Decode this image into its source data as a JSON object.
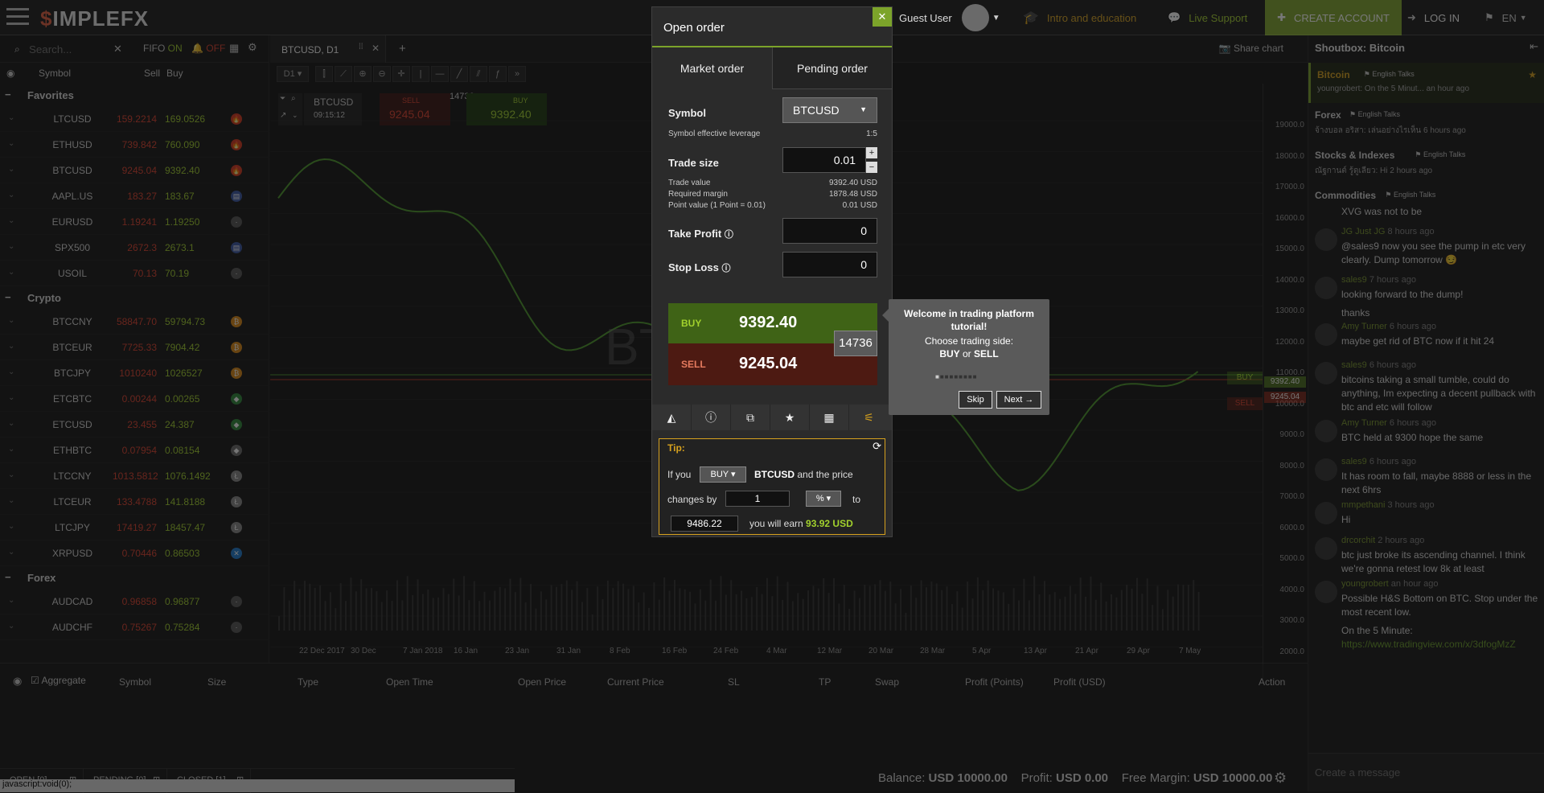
{
  "brand": {
    "logo_pre": "$",
    "logo_text": "IMPLEFX"
  },
  "topbar": {
    "guest": "Guest User",
    "intro": "Intro and education",
    "support": "Live Support",
    "create": "CREATE ACCOUNT",
    "login": "LOG IN",
    "lang": "EN"
  },
  "watchlist": {
    "search_placeholder": "Search...",
    "fifo_label": "FIFO",
    "fifo_on": "ON",
    "off_label": "OFF",
    "col_symbol": "Symbol",
    "col_sell": "Sell",
    "col_buy": "Buy",
    "groups": [
      {
        "name": "Favorites",
        "rows": [
          {
            "sym": "LTCUSD",
            "sell": "159.2214",
            "buy": "169.0526",
            "icon": "flame-icon"
          },
          {
            "sym": "ETHUSD",
            "sell": "739.842",
            "buy": "760.090",
            "icon": "flame-icon"
          },
          {
            "sym": "BTCUSD",
            "sell": "9245.04",
            "buy": "9392.40",
            "icon": "flame-icon"
          },
          {
            "sym": "AAPL.US",
            "sell": "183.27",
            "buy": "183.67",
            "icon": "us-flag-icon"
          },
          {
            "sym": "EURUSD",
            "sell": "1.19241",
            "buy": "1.19250",
            "icon": "curr-icon"
          },
          {
            "sym": "SPX500",
            "sell": "2672.3",
            "buy": "2673.1",
            "icon": "us-flag-icon"
          },
          {
            "sym": "USOIL",
            "sell": "70.13",
            "buy": "70.19",
            "icon": "curr-icon"
          }
        ]
      },
      {
        "name": "Crypto",
        "rows": [
          {
            "sym": "BTCCNY",
            "sell": "58847.70",
            "buy": "59794.73",
            "icon": "bitcoin-icon"
          },
          {
            "sym": "BTCEUR",
            "sell": "7725.33",
            "buy": "7904.42",
            "icon": "bitcoin-icon"
          },
          {
            "sym": "BTCJPY",
            "sell": "1010240",
            "buy": "1026527",
            "icon": "bitcoin-icon"
          },
          {
            "sym": "ETCBTC",
            "sell": "0.00244",
            "buy": "0.00265",
            "icon": "etc-icon"
          },
          {
            "sym": "ETCUSD",
            "sell": "23.455",
            "buy": "24.387",
            "icon": "etc-icon"
          },
          {
            "sym": "ETHBTC",
            "sell": "0.07954",
            "buy": "0.08154",
            "icon": "eth-icon"
          },
          {
            "sym": "LTCCNY",
            "sell": "1013.5812",
            "buy": "1076.1492",
            "icon": "ltc-icon"
          },
          {
            "sym": "LTCEUR",
            "sell": "133.4788",
            "buy": "141.8188",
            "icon": "ltc-icon"
          },
          {
            "sym": "LTCJPY",
            "sell": "17419.27",
            "buy": "18457.47",
            "icon": "ltc-icon"
          },
          {
            "sym": "XRPUSD",
            "sell": "0.70446",
            "buy": "0.86503",
            "icon": "xrp-icon"
          }
        ]
      },
      {
        "name": "Forex",
        "rows": [
          {
            "sym": "AUDCAD",
            "sell": "0.96858",
            "buy": "0.96877",
            "icon": "curr-icon"
          },
          {
            "sym": "AUDCHF",
            "sell": "0.75267",
            "buy": "0.75284",
            "icon": "curr-icon"
          }
        ]
      }
    ]
  },
  "chart": {
    "tab": "BTCUSD, D1",
    "timeframe": "D1",
    "share": "Share chart",
    "quote_symbol": "BTCUSD",
    "quote_time": "09:15:12",
    "quote_sell_label": "SELL",
    "quote_sell": "9245.04",
    "quote_buy_label": "BUY",
    "quote_buy": "9392.40",
    "spread": "14736",
    "watermark": "BTC",
    "yticks": [
      "19000.0",
      "18000.0",
      "17000.0",
      "16000.0",
      "15000.0",
      "14000.0",
      "13000.0",
      "12000.0",
      "11000.0",
      "10000.0",
      "9000.0",
      "8000.0",
      "7000.0",
      "6000.0",
      "5000.0",
      "4000.0",
      "3000.0",
      "2000.0"
    ],
    "xticks": [
      "22 Dec 2017",
      "30 Dec",
      "7 Jan 2018",
      "16 Jan",
      "23 Jan",
      "31 Jan",
      "8 Feb",
      "16 Feb",
      "24 Feb",
      "4 Mar",
      "12 Mar",
      "20 Mar",
      "28 Mar",
      "5 Apr",
      "13 Apr",
      "21 Apr",
      "29 Apr",
      "7 May"
    ],
    "buy_tag": "BUY",
    "buy_price": "9392.40",
    "sell_tag": "SELL",
    "sell_price": "9245.04"
  },
  "positions": {
    "aggregate": "Aggregate",
    "cols": [
      "Symbol",
      "Size",
      "Type",
      "Open Time",
      "Open Price",
      "Current Price",
      "SL",
      "TP",
      "Swap",
      "Profit (Points)",
      "Profit (USD)",
      "Action"
    ],
    "tabs": [
      "OPEN [0]",
      "PENDING [0]",
      "CLOSED [1]"
    ],
    "status_url": "javascript:void(0);",
    "balance_label": "Balance:",
    "balance": "USD 10000.00",
    "profit_label": "Profit:",
    "profit": "USD 0.00",
    "margin_label": "Free Margin:",
    "margin": "USD 10000.00"
  },
  "modal": {
    "title": "Open order",
    "tab_market": "Market order",
    "tab_pending": "Pending order",
    "symbol_label": "Symbol",
    "symbol_value": "BTCUSD",
    "leverage_label": "Symbol effective leverage",
    "leverage": "1:5",
    "tradesize_label": "Trade size",
    "tradesize": "0.01",
    "tv_label": "Trade value",
    "tv": "9392.40 USD",
    "rm_label": "Required margin",
    "rm": "1878.48 USD",
    "pv_label": "Point value (1 Point = 0.01)",
    "pv": "0.01 USD",
    "tp_label": "Take Profit",
    "tp": "0",
    "sl_label": "Stop Loss",
    "sl": "0",
    "buy_label": "BUY",
    "buy_price": "9392.40",
    "sell_label": "SELL",
    "sell_price": "9245.04",
    "spread": "14736",
    "tip_title": "Tip:",
    "tip_if": "If you",
    "tip_side": "BUY",
    "tip_symbol": "BTCUSD",
    "tip_andprice": "and the price",
    "tip_changes": "changes by",
    "tip_amount": "1",
    "tip_unit": "%",
    "tip_to": "to",
    "tip_target": "9486.22",
    "tip_earn": "you will earn",
    "tip_earn_value": "93.92 USD"
  },
  "tour": {
    "title": "Welcome in trading platform tutorial!",
    "line2": "Choose trading side:",
    "buy": "BUY",
    "or": "or",
    "sell": "SELL",
    "skip": "Skip",
    "next": "Next →"
  },
  "shoutbox": {
    "title": "Shoutbox: Bitcoin",
    "rooms": [
      {
        "name": "Bitcoin",
        "lang": "English Talks",
        "last": "youngrobert: On the 5 Minut...",
        "time": "an hour ago"
      },
      {
        "name": "Forex",
        "lang": "English Talks",
        "last": "จ้างบอล อริสา: เล่นอย่างไรเห็น",
        "time": "6 hours ago"
      },
      {
        "name": "Stocks & Indexes",
        "lang": "English Talks",
        "last": "ณัฐกานต์ รู้ดูเลียว: Hi",
        "time": "2 hours ago"
      },
      {
        "name": "Commodities",
        "lang": "English Talks",
        "last": "",
        "time": ""
      }
    ],
    "first_text": "XVG was not to be",
    "messages": [
      {
        "user": "JG Just JG",
        "time": "8 hours ago",
        "text": "@sales9 now you see the pump in etc very clearly. Dump tomorrow 😏"
      },
      {
        "user": "sales9",
        "time": "7 hours ago",
        "text": "looking forward to the dump!",
        "text2": "thanks"
      },
      {
        "user": "Amy Turner",
        "time": "6 hours ago",
        "text": "maybe get rid of BTC now if it hit 24"
      },
      {
        "user": "sales9",
        "time": "6 hours ago",
        "text": "bitcoins taking a small tumble, could do anything, Im expecting a decent pullback with btc and etc will follow"
      },
      {
        "user": "Amy Turner",
        "time": "6 hours ago",
        "text": "BTC held at 9300 hope the same"
      },
      {
        "user": "sales9",
        "time": "6 hours ago",
        "text": "It has room to fall, maybe 8888 or less in the next 6hrs"
      },
      {
        "user": "mmpethani",
        "time": "3 hours ago",
        "text": "Hi"
      },
      {
        "user": "drcorchit",
        "time": "2 hours ago",
        "text": "btc just broke its ascending channel. I think we're gonna retest low 8k at least"
      },
      {
        "user": "youngrobert",
        "time": "an hour ago",
        "text": "Possible H&S Bottom on BTC. Stop under the most recent low.",
        "text2": "On the 5 Minute:",
        "link": "https://www.tradingview.com/x/3dfogMzZ"
      }
    ],
    "placeholder": "Create a message"
  }
}
